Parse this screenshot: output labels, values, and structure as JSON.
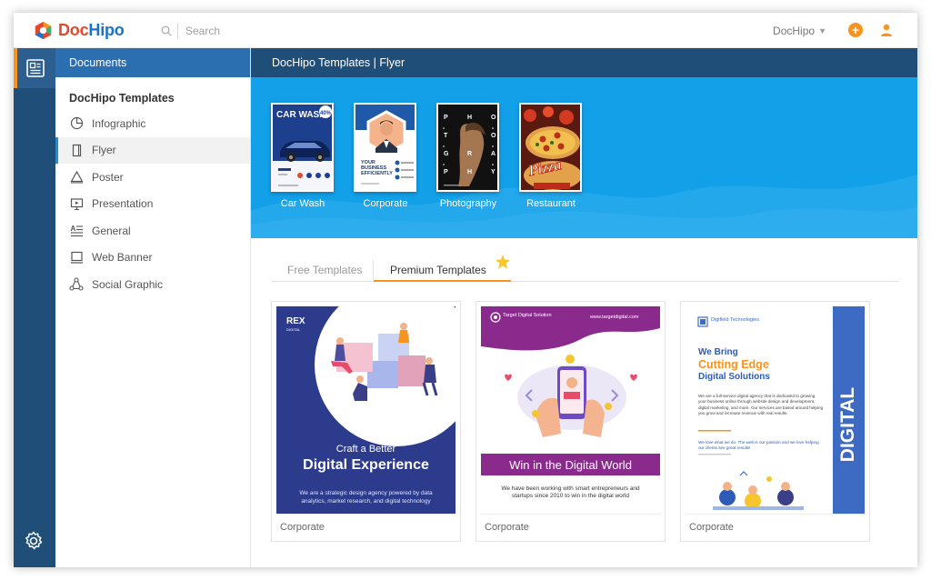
{
  "app": {
    "logo_prefix": "Doc",
    "logo_suffix": "Hipo",
    "search_placeholder": "Search",
    "account_label": "DocHipo"
  },
  "rail": {
    "items": [
      "documents-icon",
      "gear-icon"
    ]
  },
  "sidebar": {
    "header": "Documents",
    "section_title": "DocHipo Templates",
    "items": [
      {
        "label": "Infographic",
        "icon": "pie-chart-icon"
      },
      {
        "label": "Flyer",
        "icon": "flyer-icon",
        "active": true
      },
      {
        "label": "Poster",
        "icon": "triangle-icon"
      },
      {
        "label": "Presentation",
        "icon": "presentation-icon"
      },
      {
        "label": "General",
        "icon": "text-lines-icon"
      },
      {
        "label": "Web Banner",
        "icon": "monitor-icon"
      },
      {
        "label": "Social Graphic",
        "icon": "share-icon"
      }
    ]
  },
  "main": {
    "breadcrumb": "DocHipo Templates | Flyer",
    "categories": [
      {
        "label": "Car Wash"
      },
      {
        "label": "Corporate"
      },
      {
        "label": "Photography"
      },
      {
        "label": "Restaurant"
      }
    ],
    "tabs": {
      "free": "Free Templates",
      "premium": "Premium Templates"
    },
    "cards": [
      {
        "caption": "Corporate",
        "brand": "REX",
        "brand_sub": "DIGITAL",
        "kicker": "Craft a Better",
        "headline": "Digital Experience",
        "body": "We are a strategic design agency powered by data analytics, market research, and digital technology"
      },
      {
        "caption": "Corporate",
        "brand": "Target Digital Solution",
        "url": "www.targetdigital.com",
        "headline": "Win in the Digital World",
        "body": "We have been working with smart entrepreneurs and startups since 2010 to win in the digital world"
      },
      {
        "caption": "Corporate",
        "brand": "Digifield Technologies",
        "line1": "We Bring",
        "line2": "Cutting Edge",
        "line3": "Digital Solutions",
        "body": "We are a full-service digital agency that is dedicated to growing your business online through website design and development, digital marketing, and more. Our services are based around helping you grow and increase revenue with real results.",
        "body2": "We love what we do. The web is our passion and we love helping our clients see great results!",
        "side_text": "DIGITAL"
      }
    ],
    "thumbs": {
      "carwash_title": "CAR WASH",
      "carwash_badge": "40%",
      "corporate_text": "YOUR BUSINESS EFFICIENTLY",
      "photo_letters": [
        "P",
        "H",
        "O",
        "T",
        "O",
        "G",
        "R",
        "A",
        "P",
        "H",
        "Y"
      ],
      "pizza_text": "Pizza"
    }
  },
  "colors": {
    "brand_orange": "#f7931e",
    "rail_blue": "#1f4e79",
    "banner_blue": "#12a0e8",
    "card1_blue": "#2d3b8c",
    "card2_purple": "#8a2a8c",
    "card3_blue": "#3d6bc4"
  }
}
